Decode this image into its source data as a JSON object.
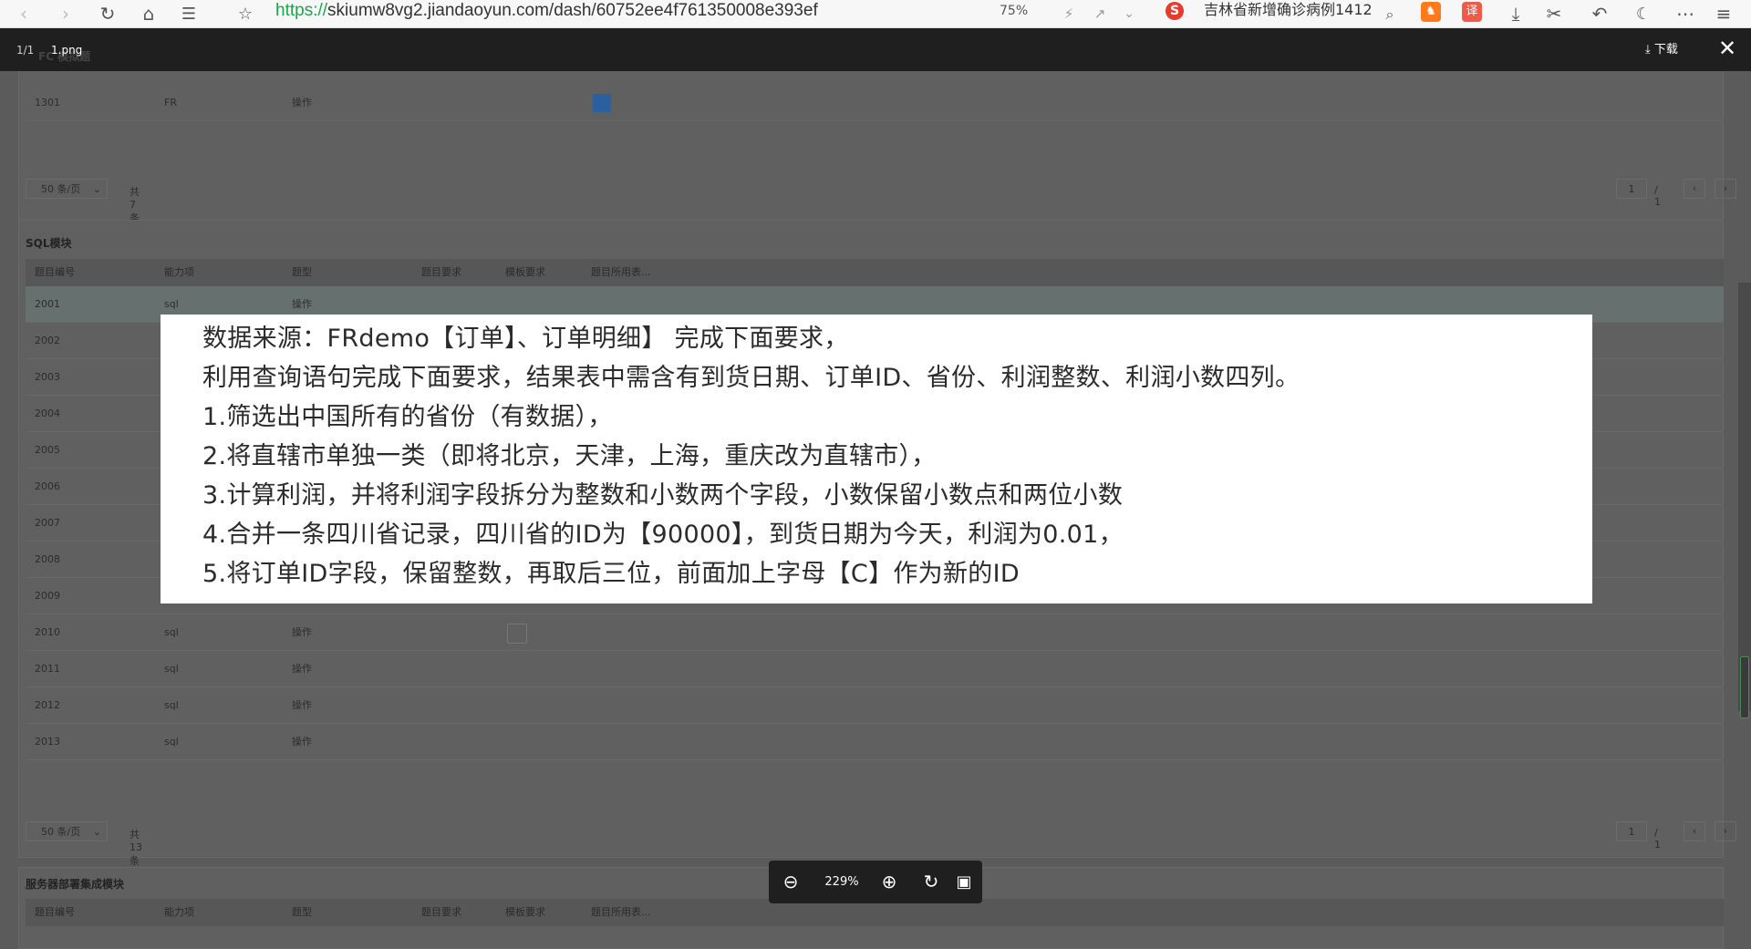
{
  "browser": {
    "url_protocol": "https://",
    "url_rest": "skiumw8vg2.jiandaoyun.com/dash/60752ee4f761350008e393ef",
    "zoom": "75%",
    "search_text": "吉林省新增确诊病例1412",
    "translate_label": "译",
    "sogou_label": "S"
  },
  "viewer": {
    "counter": "1/1",
    "filename": "1.png",
    "download_label": "下载",
    "zoom_percent": "229%"
  },
  "background": {
    "top_ghost_title": "FC 模拟题",
    "top_table": {
      "rows": [
        {
          "id": "1301",
          "ability": "FR",
          "type": "操作"
        }
      ],
      "page_size": "50 条/页",
      "total": "共7条",
      "page": "1",
      "page_total": "/ 1"
    },
    "sql_section": {
      "title": "SQL模块",
      "columns": [
        "题目编号",
        "能力项",
        "题型",
        "题目要求",
        "模板要求",
        "题目所用表..."
      ],
      "rows": [
        {
          "id": "2001",
          "ability": "sql",
          "type": "操作"
        },
        {
          "id": "2002",
          "ability": "",
          "type": ""
        },
        {
          "id": "2003",
          "ability": "",
          "type": ""
        },
        {
          "id": "2004",
          "ability": "",
          "type": ""
        },
        {
          "id": "2005",
          "ability": "",
          "type": ""
        },
        {
          "id": "2006",
          "ability": "",
          "type": ""
        },
        {
          "id": "2007",
          "ability": "",
          "type": ""
        },
        {
          "id": "2008",
          "ability": "",
          "type": ""
        },
        {
          "id": "2009",
          "ability": "",
          "type": ""
        },
        {
          "id": "2010",
          "ability": "sql",
          "type": "操作"
        },
        {
          "id": "2011",
          "ability": "sql",
          "type": "操作"
        },
        {
          "id": "2012",
          "ability": "sql",
          "type": "操作"
        },
        {
          "id": "2013",
          "ability": "sql",
          "type": "操作"
        }
      ],
      "page_size": "50 条/页",
      "total": "共13条",
      "page": "1",
      "page_total": "/ 1"
    },
    "server_section": {
      "title": "服务器部署集成模块",
      "columns": [
        "题目编号",
        "能力项",
        "题型",
        "题目要求",
        "模板要求",
        "题目所用表..."
      ]
    }
  },
  "image_text": [
    "数据来源：FRdemo【订单】、订单明细】 完成下面要求，",
    "利用查询语句完成下面要求，结果表中需含有到货日期、订单ID、省份、利润整数、利润小数四列。",
    "1.筛选出中国所有的省份（有数据），",
    "2.将直辖市单独一类（即将北京，天津，上海，重庆改为直辖市），",
    "3.计算利润，并将利润字段拆分为整数和小数两个字段，小数保留小数点和两位小数",
    "4.合并一条四川省记录，四川省的ID为【90000】，到货日期为今天，利润为0.01，",
    "5.将订单ID字段，保留整数，再取后三位，前面加上字母【C】作为新的ID"
  ],
  "icons": {
    "back": "arrow-left-icon",
    "forward": "arrow-right-icon",
    "reload": "reload-icon",
    "home": "home-icon",
    "reader": "book-icon",
    "star": "star-icon",
    "zoom_out": "zoom-out-icon",
    "zoom_in": "zoom-in-icon",
    "rotate": "rotate-icon",
    "original": "image-icon",
    "close": "close-icon",
    "download": "download-icon"
  },
  "colors": {
    "viewer_bar": "#1f1f1f",
    "overlay_page": "#5b5b5b",
    "url_protocol": "#1aa64a",
    "image_bg": "#ffffff",
    "image_text": "#2b2b2b"
  }
}
